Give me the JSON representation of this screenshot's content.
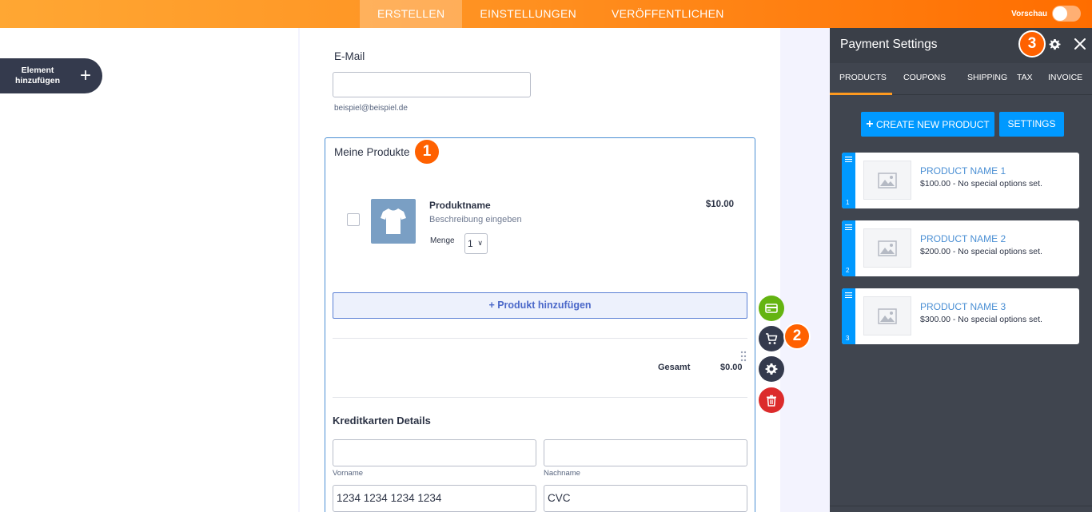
{
  "topbar": {
    "tabs": [
      {
        "label": "ERSTELLEN",
        "active": true
      },
      {
        "label": "EINSTELLUNGEN",
        "active": false
      },
      {
        "label": "VERÖFFENTLICHEN",
        "active": false
      }
    ],
    "preview_label": "Vorschau",
    "preview_on": false
  },
  "sidebar": {
    "add_element_label": "Element hinzufügen",
    "add_icon": "plus-icon"
  },
  "form": {
    "email": {
      "label": "E-Mail",
      "value": "",
      "sublabel": "beispiel@beispiel.de"
    },
    "products": {
      "title": "Meine Produkte",
      "items": [
        {
          "name": "Produktname",
          "description": "Beschreibung eingeben",
          "quantity_label": "Menge",
          "quantity": "1",
          "price": "$10.00",
          "checked": false,
          "image_icon": "tshirt-icon"
        }
      ],
      "add_button_label": "+ Produkt hinzufügen",
      "total_label": "Gesamt",
      "total_value": "$0.00"
    },
    "credit_card": {
      "title": "Kreditkarten Details",
      "first_name_value": "",
      "first_name_sublabel": "Vorname",
      "last_name_value": "",
      "last_name_sublabel": "Nachname",
      "card_number_value": "1234 1234 1234 1234",
      "cvc_value": "CVC"
    }
  },
  "markers": [
    "1",
    "2",
    "3"
  ],
  "actions": [
    {
      "name": "payment-card-icon",
      "color": "#64b411"
    },
    {
      "name": "cart-icon",
      "color": "#343a4d"
    },
    {
      "name": "gear-icon",
      "color": "#343a4d"
    },
    {
      "name": "trash-icon",
      "color": "#dc2b2b"
    }
  ],
  "panel": {
    "title": "Payment Settings",
    "tabs": [
      {
        "label": "PRODUCTS",
        "active": true
      },
      {
        "label": "COUPONS",
        "active": false
      },
      {
        "label": "SHIPPING",
        "active": false
      },
      {
        "label": "TAX",
        "active": false
      },
      {
        "label": "INVOICE",
        "active": false
      }
    ],
    "create_button_label": "CREATE NEW PRODUCT",
    "settings_button_label": "SETTINGS",
    "products": [
      {
        "index": "1",
        "name": "PRODUCT NAME 1",
        "details": "$100.00 - No special options set."
      },
      {
        "index": "2",
        "name": "PRODUCT NAME 2",
        "details": "$200.00 - No special options set."
      },
      {
        "index": "3",
        "name": "PRODUCT NAME 3",
        "details": "$300.00 - No special options set."
      }
    ]
  },
  "colors": {
    "accent_orange": "#ff6100",
    "panel_bg": "#40454f",
    "primary_blue": "#0099ff",
    "link_blue": "#4a8fd4"
  }
}
